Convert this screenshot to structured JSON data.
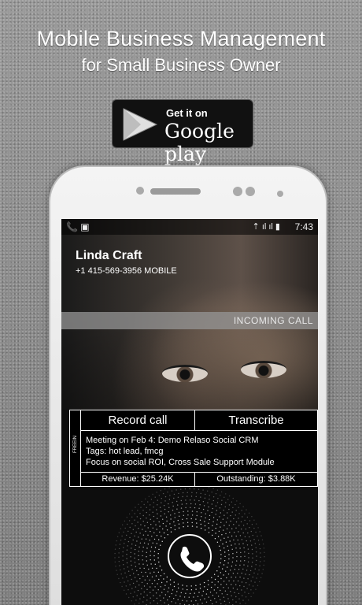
{
  "promo": {
    "headline": "Mobile Business Management",
    "subheadline": "for Small Business Owner"
  },
  "badge": {
    "small_text": "Get it on",
    "big_text": "Google play"
  },
  "status_bar": {
    "left_icons": "📞 ▣",
    "signal": "⇡ ıl ıl ▮",
    "time": "7:43"
  },
  "call": {
    "caller_name": "Linda Craft",
    "caller_number": "+1 415-569-3956 MOBILE",
    "state_label": "INCOMING CALL"
  },
  "crm": {
    "side_tab_label": "FREEIN",
    "record_label": "Record call",
    "transcribe_label": "Transcribe",
    "notes": [
      "Meeting on Feb 4: Demo Relaso Social CRM",
      "Tags: hot lead, fmcg",
      "Focus on social ROI, Cross Sale Support Module"
    ],
    "revenue": "Revenue: $25.24K",
    "outstanding": "Outstanding: $3.88K"
  },
  "icons": {
    "play": "play-triangle-icon",
    "answer": "phone-handset-icon"
  }
}
